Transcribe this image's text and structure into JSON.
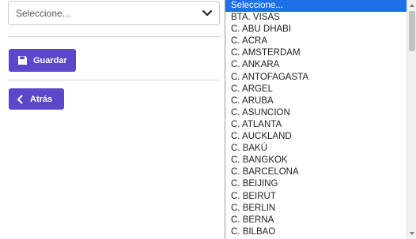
{
  "form": {
    "select_value": "Seleccione...",
    "guardar_label": "Guardar",
    "atras_label": "Atrás"
  },
  "dropdown": {
    "options": [
      "Seleccione...",
      "BTA. VISAS",
      "C. ABU DHABI",
      "C. ACRA",
      "C. AMSTERDAM",
      "C. ANKARA",
      "C. ANTOFAGASTA",
      "C. ARGEL",
      "C. ARUBA",
      "C. ASUNCION",
      "C. ATLANTA",
      "C. AUCKLAND",
      "C. BAKÚ",
      "C. BANGKOK",
      "C. BARCELONA",
      "C. BEIJING",
      "C. BEIRUT",
      "C. BERLIN",
      "C. BERNA",
      "C. BILBAO"
    ],
    "selected_index": 0
  },
  "colors": {
    "button": "#5b47c9",
    "selected_option": "#1e6fe8"
  },
  "icons": {
    "select_arrow": "chevron-down-icon",
    "guardar": "save-icon",
    "atras": "chevron-left-icon"
  }
}
